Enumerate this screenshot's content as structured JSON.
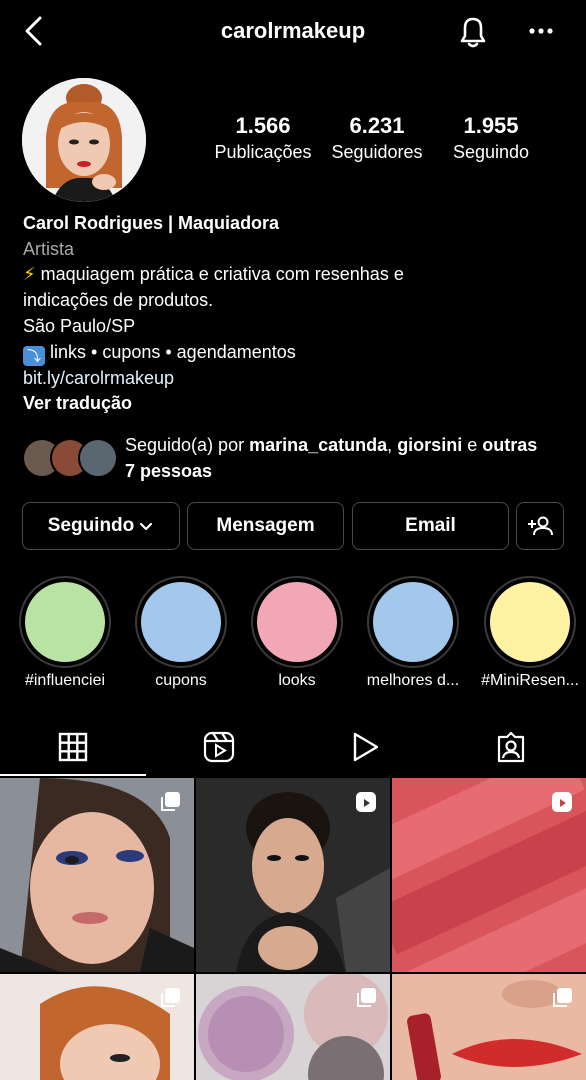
{
  "header": {
    "username": "carolrmakeup"
  },
  "stats": [
    {
      "value": "1.566",
      "label": "Publicações"
    },
    {
      "value": "6.231",
      "label": "Seguidores"
    },
    {
      "value": "1.955",
      "label": "Seguindo"
    }
  ],
  "bio": {
    "name": "Carol Rodrigues | Maquiadora",
    "category": "Artista",
    "line1_emoji": "⚡",
    "line1_text": "maquiagem prática e criativa com resenhas e",
    "line2": "indicações de produtos.",
    "location": "São Paulo/SP",
    "line4_emoji": "⤵",
    "line4_text": "links • cupons • agendamentos",
    "link": "bit.ly/carolrmakeup",
    "translate": "Ver tradução"
  },
  "followed_by": {
    "prefix": "Seguido(a) por",
    "user1": "marina_catunda",
    "separator": ",",
    "user2": "giorsini",
    "conjunction": "e",
    "others": "outras 7 pessoas"
  },
  "buttons": {
    "following": "Seguindo",
    "message": "Mensagem",
    "email": "Email"
  },
  "highlights": [
    {
      "label": "#influenciei",
      "color": "#b9e3a3"
    },
    {
      "label": "cupons",
      "color": "#a3c8ec"
    },
    {
      "label": "looks",
      "color": "#f1a7b5"
    },
    {
      "label": "melhores d...",
      "color": "#a3c8ec"
    },
    {
      "label": "#MiniResen...",
      "color": "#fff3a3"
    }
  ],
  "tabs": [
    "grid-icon",
    "reels-icon",
    "video-play-icon",
    "tagged-icon"
  ],
  "accent_colors": {
    "background": "#000000",
    "border": "#4a4a4a",
    "muted": "#a8a8a8"
  }
}
